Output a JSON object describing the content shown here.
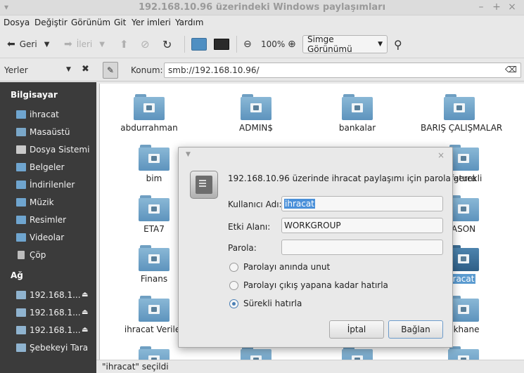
{
  "window": {
    "title": "192.168.10.96 üzerindeki Windows paylaşımları",
    "controls": [
      "–",
      "+",
      "×"
    ]
  },
  "menu": [
    "Dosya",
    "Değiştir",
    "Görünüm",
    "Git",
    "Yer imleri",
    "Yardım"
  ],
  "toolbar": {
    "back_label": "Geri",
    "forward_label": "İleri",
    "zoom_level": "100%",
    "view_mode": "Simge Görünümü"
  },
  "location": {
    "places_label": "Yerler",
    "label": "Konum:",
    "value": "smb://192.168.10.96/"
  },
  "sidebar": {
    "computer_header": "Bilgisayar",
    "computer_items": [
      {
        "label": "ihracat",
        "icon": "folder-home-icon"
      },
      {
        "label": "Masaüstü",
        "icon": "desktop-icon"
      },
      {
        "label": "Dosya Sistemi",
        "icon": "drive-icon"
      },
      {
        "label": "Belgeler",
        "icon": "folder-documents-icon"
      },
      {
        "label": "İndirilenler",
        "icon": "folder-downloads-icon"
      },
      {
        "label": "Müzik",
        "icon": "folder-music-icon"
      },
      {
        "label": "Resimler",
        "icon": "folder-pictures-icon"
      },
      {
        "label": "Videolar",
        "icon": "folder-videos-icon"
      },
      {
        "label": "Çöp",
        "icon": "trash-icon"
      }
    ],
    "network_header": "Ağ",
    "network_items": [
      {
        "label": "192.168.1..."
      },
      {
        "label": "192.168.1..."
      },
      {
        "label": "192.168.1..."
      },
      {
        "label": "Şebekeyi Tara"
      }
    ]
  },
  "shares": [
    "abdurrahman",
    "ADMIN$",
    "bankalar",
    "BARIŞ ÇALIŞMALAR",
    "bim",
    "fatura",
    "ETA7",
    "ASON",
    "Finans",
    "racat",
    "ihracat Veriler",
    "tikhane"
  ],
  "status": "\"ihracat\" seçildi",
  "dialog": {
    "message": "192.168.10.96 üzerinde ihracat paylaşımı için parola gerekli",
    "username_label": "Kullanıcı Adı:",
    "username_value": "ihracat",
    "domain_label": "Etki Alanı:",
    "domain_value": "WORKGROUP",
    "password_label": "Parola:",
    "password_value": "",
    "options": [
      {
        "label": "Parolayı anında unut",
        "selected": false
      },
      {
        "label": "Parolayı çıkış yapana kadar hatırla",
        "selected": false
      },
      {
        "label": "Sürekli hatırla",
        "selected": true
      }
    ],
    "cancel_label": "İptal",
    "connect_label": "Bağlan",
    "close": "×"
  },
  "colors": {
    "sidebar_bg": "#3b3b3b",
    "folder_blue": "#6e9fc6",
    "selection": "#4a90d9"
  }
}
